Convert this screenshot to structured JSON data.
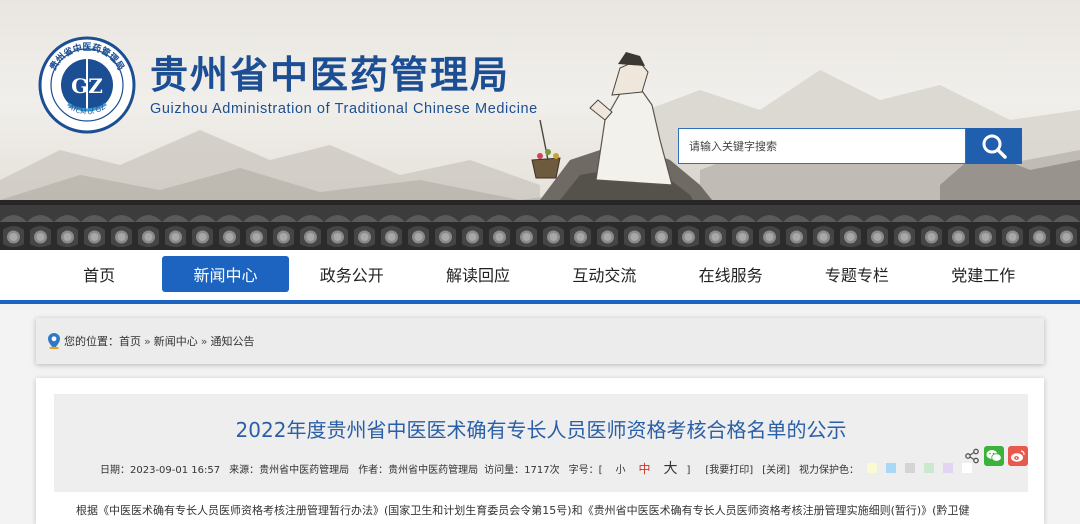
{
  "header": {
    "title_cn": "贵州省中医药管理局",
    "title_en": "Guizhou  Administration of Traditional Chinese Medicine",
    "logo_ring_text": "贵州省中医药管理局",
    "logo_center": "GZ",
    "logo_bottom_text": "ATCM of GZ"
  },
  "search": {
    "placeholder": "请输入关键字搜索",
    "icon": "search-icon"
  },
  "nav": {
    "items": [
      {
        "label": "首页"
      },
      {
        "label": "新闻中心"
      },
      {
        "label": "政务公开"
      },
      {
        "label": "解读回应"
      },
      {
        "label": "互动交流"
      },
      {
        "label": "在线服务"
      },
      {
        "label": "专题专栏"
      },
      {
        "label": "党建工作"
      }
    ],
    "active_index": 1
  },
  "breadcrumb": {
    "prefix": "您的位置：",
    "home": "首页",
    "sep": "»",
    "section": "新闻中心",
    "current": "通知公告"
  },
  "article": {
    "title": "2022年度贵州省中医医术确有专长人员医师资格考核合格名单的公示",
    "date": "日期：2023-09-01 16:57",
    "source": "来源：贵州省中医药管理局",
    "author": "作者：贵州省中医药管理局",
    "visits": "访问量：1717次",
    "font_label": "字号：[",
    "font_small": "小",
    "font_mid": "中",
    "font_big": "大",
    "font_end": "]",
    "print": "[我要打印]",
    "close": "[关闭]",
    "eye_label": "视力保护色：",
    "eye_colors": [
      "#fafad2",
      "#a9d7f5",
      "#d4d4d4",
      "#cbe9cd",
      "#e4d4f4",
      "#ffffff"
    ],
    "body_start": "根据《中医医术确有专长人员医师资格考核注册管理暂行办法》(国家卫生和计划生育委员会令第15号)和《贵州省中医医术确有专长人员医师资格考核注册管理实施细则(暂行)》(黔卫健"
  },
  "share": {
    "icons": [
      "share-icon",
      "wechat-icon",
      "weibo-icon"
    ]
  },
  "colors": {
    "brand_blue": "#1c4e93",
    "nav_active": "#1d64c0",
    "title_blue": "#2a5fa8",
    "wechat": "#3bb23b",
    "weibo": "#e8584c"
  }
}
